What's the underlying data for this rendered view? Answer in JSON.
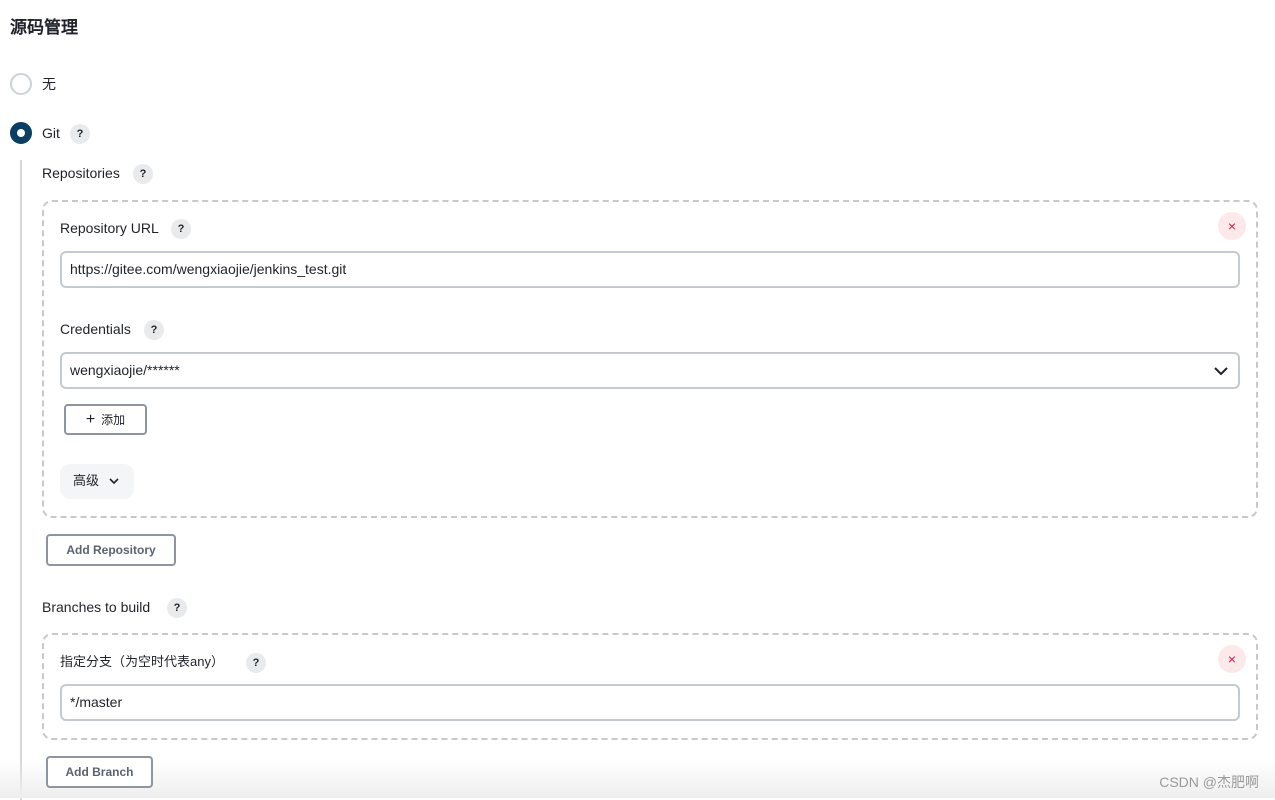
{
  "section_title": "源码管理",
  "scm_options": [
    {
      "label": "无",
      "selected": false
    },
    {
      "label": "Git",
      "selected": true
    }
  ],
  "help_glyph": "?",
  "repositories": {
    "label": "Repositories",
    "url_label": "Repository URL",
    "url_value": "https://gitee.com/wengxiaojie/jenkins_test.git",
    "credentials_label": "Credentials",
    "credentials_value": "wengxiaojie/******",
    "add_label": "添加",
    "advanced_label": "高级",
    "add_repository_label": "Add Repository"
  },
  "branches": {
    "label": "Branches to build",
    "branch_label": "指定分支（为空时代表any）",
    "branch_value": "*/master",
    "add_branch_label": "Add Branch"
  },
  "delete_glyph": "×",
  "watermark": "CSDN @杰肥啊",
  "colors": {
    "accent": "#0b3e63",
    "danger": "#e3173d"
  }
}
